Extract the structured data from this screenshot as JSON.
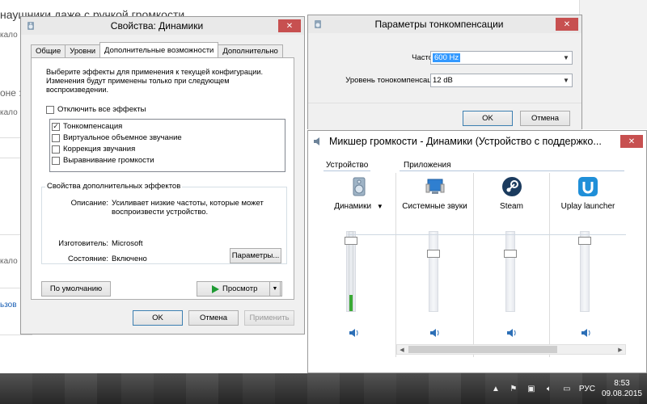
{
  "background": {
    "heading": "наушники даже с ручкой громкости",
    "side_items": [
      "кало",
      "оне :",
      "кало",
      "кало"
    ],
    "link": "ьзов"
  },
  "props": {
    "title": "Свойства: Динамики",
    "tabs": [
      "Общие",
      "Уровни",
      "Дополнительные возможности",
      "Дополнительно"
    ],
    "description": "Выберите эффекты для применения к текущей конфигурации. Изменения будут применены только при следующем воспроизведении.",
    "disable_all": {
      "label": "Отключить все эффекты",
      "checked": false
    },
    "effects": [
      {
        "label": "Тонкомпенсация",
        "checked": true
      },
      {
        "label": "Виртуальное объемное звучание",
        "checked": false
      },
      {
        "label": "Коррекция звучания",
        "checked": false
      },
      {
        "label": "Выравнивание громкости",
        "checked": false
      }
    ],
    "group_label": "Свойства дополнительных эффектов",
    "description_key": "Описание:",
    "description_val": "Усиливает низкие частоты, которые может воспроизвести устройство.",
    "vendor_key": "Изготовитель:",
    "vendor_val": "Microsoft",
    "state_key": "Состояние:",
    "state_val": "Включено",
    "params_button": "Параметры...",
    "default_button": "По умолчанию",
    "preview_button": "Просмотр",
    "ok": "OK",
    "cancel": "Отмена",
    "apply": "Применить"
  },
  "loudness": {
    "title": "Параметры тонкомпенсации",
    "freq_label": "Частота:",
    "freq_value": "600 Hz",
    "level_label": "Уровень тонокомпенсации:",
    "level_value": "12 dB",
    "ok": "OK",
    "cancel": "Отмена"
  },
  "mixer": {
    "title": "Микшер громкости - Динамики (Устройство с поддержко...",
    "device_label": "Устройство",
    "apps_label": "Приложения",
    "device_name": "Динамики",
    "device_level": 0.88,
    "device_meter": 0.2,
    "apps": [
      {
        "name": "Системные звуки",
        "icon": "system-sounds-icon",
        "level": 0.72
      },
      {
        "name": "Steam",
        "icon": "steam-icon",
        "level": 0.72
      },
      {
        "name": "Uplay launcher",
        "icon": "uplay-icon",
        "level": 0.88
      }
    ]
  },
  "taskbar": {
    "lang": "РУС",
    "time": "8:53",
    "date": "09.08.2015"
  }
}
